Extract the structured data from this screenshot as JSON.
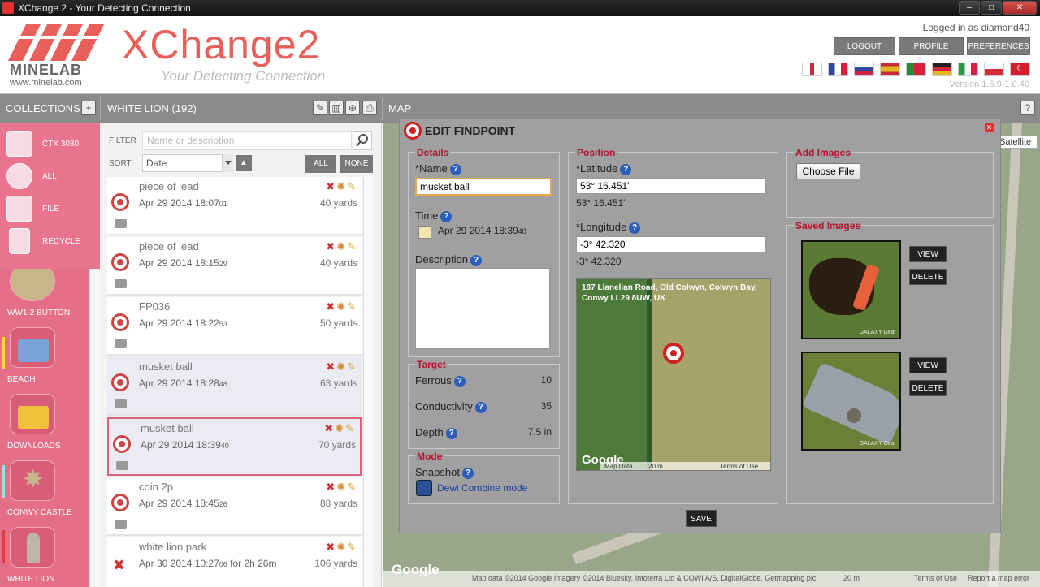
{
  "window": {
    "title": "XChange 2 - Your Detecting Connection",
    "min": "–",
    "max": "□",
    "close": "✕"
  },
  "header": {
    "minelab": "MINELAB",
    "minelab_url": "www.minelab.com",
    "xchange_text": "XChange",
    "xchange_suffix": "2",
    "tagline": "Your Detecting Connection",
    "logged_in": "Logged in as diamond40",
    "buttons": [
      "LOGOUT",
      "PROFILE",
      "PREFERENCES"
    ],
    "version": "Version 1.6.9-1.0.40",
    "flag_colors": [
      "#c62b39",
      "#2a4a9c",
      "#d7d7e8",
      "#e4b422",
      "#2a8a3a",
      "#222",
      "#2a9a48",
      "#d02c3c",
      "#d41e2c"
    ]
  },
  "toolbar": {
    "collections": "COLLECTIONS",
    "add": "+",
    "white_lion": "WHITE LION (192)",
    "map": "MAP",
    "help": "?",
    "icons": [
      "✎",
      "▥",
      "⊕",
      "⎙"
    ]
  },
  "sidebar": {
    "items": [
      {
        "label": "CTX 3030",
        "icon": "detector-icon"
      },
      {
        "label": "ALL",
        "icon": "all-icon"
      },
      {
        "label": "FILE",
        "icon": "file-icon"
      },
      {
        "label": "RECYCLE",
        "icon": "recycle-icon"
      }
    ],
    "collections": [
      {
        "label": "WW1-2 BUTTON",
        "mark": "#ffffff"
      },
      {
        "label": "BEACH",
        "mark": "#f7dc3a"
      },
      {
        "label": "DOWNLOADS",
        "mark": "#e56f86"
      },
      {
        "label": "CONWY CASTLE",
        "mark": "#8de4f2"
      },
      {
        "label": "WHITE LION",
        "mark": "#e53a3a"
      }
    ]
  },
  "list": {
    "filter_label": "FILTER",
    "filter_placeholder": "Name or description",
    "sort_label": "SORT",
    "sort_value": "Date",
    "sort_dir": "▲",
    "all": "ALL",
    "none": "NONE",
    "rows": [
      {
        "name": "piece of lead",
        "date": "Apr 29 2014 18:07",
        "sec": "01",
        "dist": "40 yards",
        "extra": ""
      },
      {
        "name": "piece of lead",
        "date": "Apr 29 2014 18:15",
        "sec": "29",
        "dist": "40 yards",
        "extra": ""
      },
      {
        "name": "FP036",
        "date": "Apr 29 2014 18:22",
        "sec": "53",
        "dist": "50 yards",
        "extra": ""
      },
      {
        "name": "musket ball",
        "date": "Apr 29 2014 18:28",
        "sec": "48",
        "dist": "63 yards",
        "extra": ""
      },
      {
        "name": "musket ball",
        "date": "Apr 29 2014 18:39",
        "sec": "40",
        "dist": "70 yards",
        "extra": ""
      },
      {
        "name": "coin 2p",
        "date": "Apr 29 2014 18:45",
        "sec": "26",
        "dist": "88 yards",
        "extra": ""
      },
      {
        "name": "white lion park",
        "date": "Apr 30 2014 10:27",
        "sec": "06",
        "dist": "106 yards",
        "extra": " for 2h 26m"
      }
    ],
    "actions": "✖ ✺ ✎"
  },
  "map": {
    "satellite": "Satellite",
    "google": "Google",
    "footer": "Map data ©2014 Google Imagery ©2014 Bluesky, Infoterra Ltd & COWI A/S, DigitalGlobe, Getmapping plc",
    "scale": "20 m",
    "terms": "Terms of Use",
    "report": "Report a map error"
  },
  "dialog": {
    "title": "EDIT FINDPOINT",
    "close": "✕",
    "details": {
      "title": "Details",
      "name_label": "*Name",
      "name_value": "musket ball",
      "time_label": "Time",
      "time_value": "Apr 29 2014  18:39",
      "time_sec": "40",
      "description_label": "Description"
    },
    "target": {
      "title": "Target",
      "ferrous_label": "Ferrous",
      "ferrous": "10",
      "conductivity_label": "Conductivity",
      "conductivity": "35",
      "depth_label": "Depth",
      "depth": "7.5 in"
    },
    "mode": {
      "title": "Mode",
      "snapshot_label": "Snapshot",
      "mode_name": "Dewi Combine mode"
    },
    "position": {
      "title": "Position",
      "latitude_label": "*Latitude",
      "latitude_value": "53° 16.451'",
      "latitude_display": "53° 16.451'",
      "longitude_label": "*Longitude",
      "longitude_value": "-3° 42.320'",
      "longitude_display": "-3° 42.320'",
      "address": "187 Llanelian Road, Old Colwyn, Colwyn Bay, Conwy LL29 8UW, UK",
      "map_data": "Map Data",
      "scale": "20 m",
      "terms": "Terms of Use",
      "google": "Google"
    },
    "add_images": {
      "title": "Add Images",
      "choose_file": "Choose File"
    },
    "saved_images": {
      "title": "Saved Images",
      "view": "VIEW",
      "delete": "DELETE",
      "caption": "GALAXY Gear"
    },
    "save": "SAVE",
    "help": "?"
  }
}
